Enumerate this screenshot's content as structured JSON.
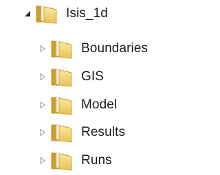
{
  "tree": {
    "root": {
      "label": "Isis_1d",
      "expanded": true,
      "icon": "folder-icon"
    },
    "children": [
      {
        "label": "Boundaries",
        "expanded": false,
        "icon": "folder-icon"
      },
      {
        "label": "GIS",
        "expanded": false,
        "icon": "folder-icon"
      },
      {
        "label": "Model",
        "expanded": false,
        "icon": "folder-icon"
      },
      {
        "label": "Results",
        "expanded": false,
        "icon": "folder-icon"
      },
      {
        "label": "Runs",
        "expanded": false,
        "icon": "folder-icon"
      }
    ]
  },
  "colors": {
    "folder_back": "#d9b23c",
    "folder_front": "#f6d873",
    "arrow_expanded": "#262626",
    "arrow_collapsed": "#a6a6a6",
    "text": "#1a1a1a"
  }
}
